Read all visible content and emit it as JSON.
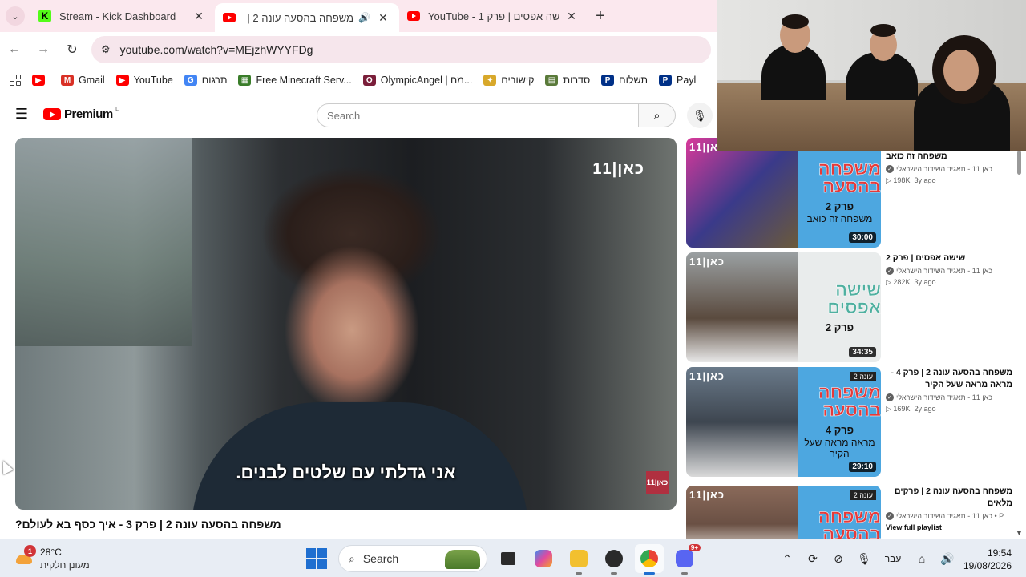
{
  "browser": {
    "tabs": [
      {
        "title": "Stream - Kick Dashboard",
        "favicon": "kick-icon",
        "active": false
      },
      {
        "title": "משפחה בהסעה עונה 2 | פר",
        "favicon": "youtube-icon",
        "active": true,
        "audio": true
      },
      {
        "title": "YouTube - 1 שישה אפסים | פרק",
        "favicon": "youtube-icon",
        "active": false
      }
    ],
    "url": "youtube.com/watch?v=MEjzhWYYFDg",
    "bookmarks": [
      {
        "label": "",
        "icon": "youtube-icon",
        "color": "#ff0000"
      },
      {
        "label": "Gmail",
        "icon": "gmail-icon",
        "color": "#d93025"
      },
      {
        "label": "YouTube",
        "icon": "youtube-icon",
        "color": "#ff0000"
      },
      {
        "label": "תרגום",
        "icon": "translate-icon",
        "color": "#4285f4"
      },
      {
        "label": "Free Minecraft Serv...",
        "icon": "minecraft-icon",
        "color": "#3a7d2a"
      },
      {
        "label": "OlympicAngel | מח...",
        "icon": "olympic-icon",
        "color": "#7a1e3a"
      },
      {
        "label": "קישורים",
        "icon": "links-icon",
        "color": "#d8a82a"
      },
      {
        "label": "סדרות",
        "icon": "series-icon",
        "color": "#5a7a3a"
      },
      {
        "label": "תשלום",
        "icon": "paypal-icon",
        "color": "#003087"
      },
      {
        "label": "Payl",
        "icon": "paypal-icon",
        "color": "#003087"
      }
    ]
  },
  "youtube": {
    "logo_text": "Premium",
    "region": "IL",
    "search_placeholder": "Search",
    "video": {
      "title": "משפחה בהסעה עונה 2 | פרק 3 - איך כסף בא לעולם?",
      "subtitle": "אני גדלתי עם שלטים לבנים.",
      "channel_logo": "כאן|11",
      "badge": "כאן|11"
    },
    "recommended": [
      {
        "title": "משפחה זה כואב",
        "channel": "כאן 11 - תאגיד השידור הישראלי",
        "views": "198K",
        "age": "3y ago",
        "duration": "30:00",
        "poster_title": "משפחה בהסעה",
        "poster_ep": "פרק 2",
        "poster_sub": "משפחה זה כואב",
        "season": "",
        "poster_color": "#4da7e0",
        "pic_color": "#6b5a3a"
      },
      {
        "title": "שישה אפסים | פרק 2",
        "channel": "כאן 11 - תאגיד השידור הישראלי",
        "views": "282K",
        "age": "3y ago",
        "duration": "34:35",
        "poster_title": "שישה אפסים",
        "poster_ep": "פרק 2",
        "poster_sub": "",
        "season": "",
        "poster_color": "#e9ecec",
        "pic_color": "#5a4a3e"
      },
      {
        "title": "משפחה בהסעה עונה 2 | פרק 4 - מראה מראה שעל הקיר",
        "channel": "כאן 11 - תאגיד השידור הישראלי",
        "views": "169K",
        "age": "2y ago",
        "duration": "29:10",
        "poster_title": "משפחה בהסעה",
        "poster_ep": "פרק 4",
        "poster_sub": "מראה מראה שעל הקיר",
        "season": "עונה 2",
        "poster_color": "#4da7e0",
        "pic_color": "#3e4650"
      },
      {
        "title": "משפחה בהסעה עונה 2 | פרקים מלאים",
        "channel": "כאן 11 - תאגיד השידור הישראלי • P",
        "views": "",
        "age": "",
        "duration": "",
        "poster_title": "משפחה בהסעה",
        "poster_ep": "",
        "poster_sub": "",
        "season": "עונה 2",
        "poster_color": "#4da7e0",
        "pic_color": "#6a5044",
        "playlist_link": "View full playlist"
      }
    ]
  },
  "taskbar": {
    "temperature": "28°C",
    "condition": "מעונן חלקית",
    "weather_badge": "1",
    "search_label": "Search",
    "language": "עבר",
    "time": "19:54",
    "date": "19/08/2026",
    "discord_badge": "9+"
  }
}
